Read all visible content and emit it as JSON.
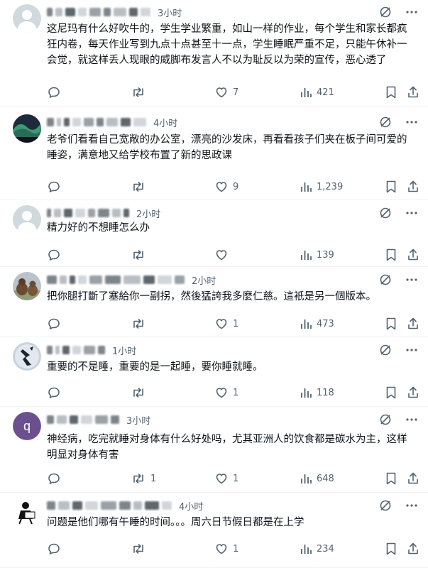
{
  "posts": [
    {
      "time": "3小时",
      "text": "这尼玛有什么好吹牛的，学生学业繁重，如山一样的作业，每个学生和家长都疯狂内卷，每天作业写到九点十点甚至十一点，学生睡眠严重不足，只能午休补一会觉，就这样丢人现眼的威脚布发言人不以为耻反以为荣的宣传，恶心透了",
      "replies": "",
      "reposts": "",
      "likes": "7",
      "views": "421"
    },
    {
      "time": "4小时",
      "text": "老爷们看看自己宽敞的办公室，漂亮的沙发床，再看看孩子们夹在板子间可爱的睡姿，满意地又给学校布置了新的思政课",
      "replies": "",
      "reposts": "",
      "likes": "9",
      "views": "1,239"
    },
    {
      "time": "2小时",
      "text": "精力好的不想睡怎么办",
      "replies": "",
      "reposts": "",
      "likes": "",
      "views": "139"
    },
    {
      "time": "2小时",
      "text": "把你腿打斷了塞給你一副拐，然後猛誇我多麼仁慈。這衹是另一個版本。",
      "replies": "",
      "reposts": "",
      "likes": "1",
      "views": "473"
    },
    {
      "time": "1小时",
      "text": "重要的不是睡，重要的是一起睡，要你睡就睡。",
      "replies": "",
      "reposts": "",
      "likes": "1",
      "views": "118"
    },
    {
      "time": "3小时",
      "avatar_letter": "q",
      "text": "神经病，吃完就睡对身体有什么好处吗，尤其亚洲人的饮食都是碳水为主，这样明显对身体有害",
      "replies": "",
      "reposts": "1",
      "likes": "1",
      "views": "648"
    },
    {
      "time": "4小时",
      "text": "问题是他们哪有午睡的时间。。。周六日节假日都是在上学",
      "replies": "",
      "reposts": "",
      "likes": "1",
      "views": "234"
    }
  ],
  "colors": {
    "text": "#0f1419",
    "muted": "#536471",
    "divider": "#eff3f4",
    "avatar_q": "#6b4f8f"
  },
  "icons": [
    "grok-icon",
    "more-icon",
    "reply-icon",
    "repost-icon",
    "like-icon",
    "views-icon",
    "bookmark-icon",
    "share-icon"
  ]
}
